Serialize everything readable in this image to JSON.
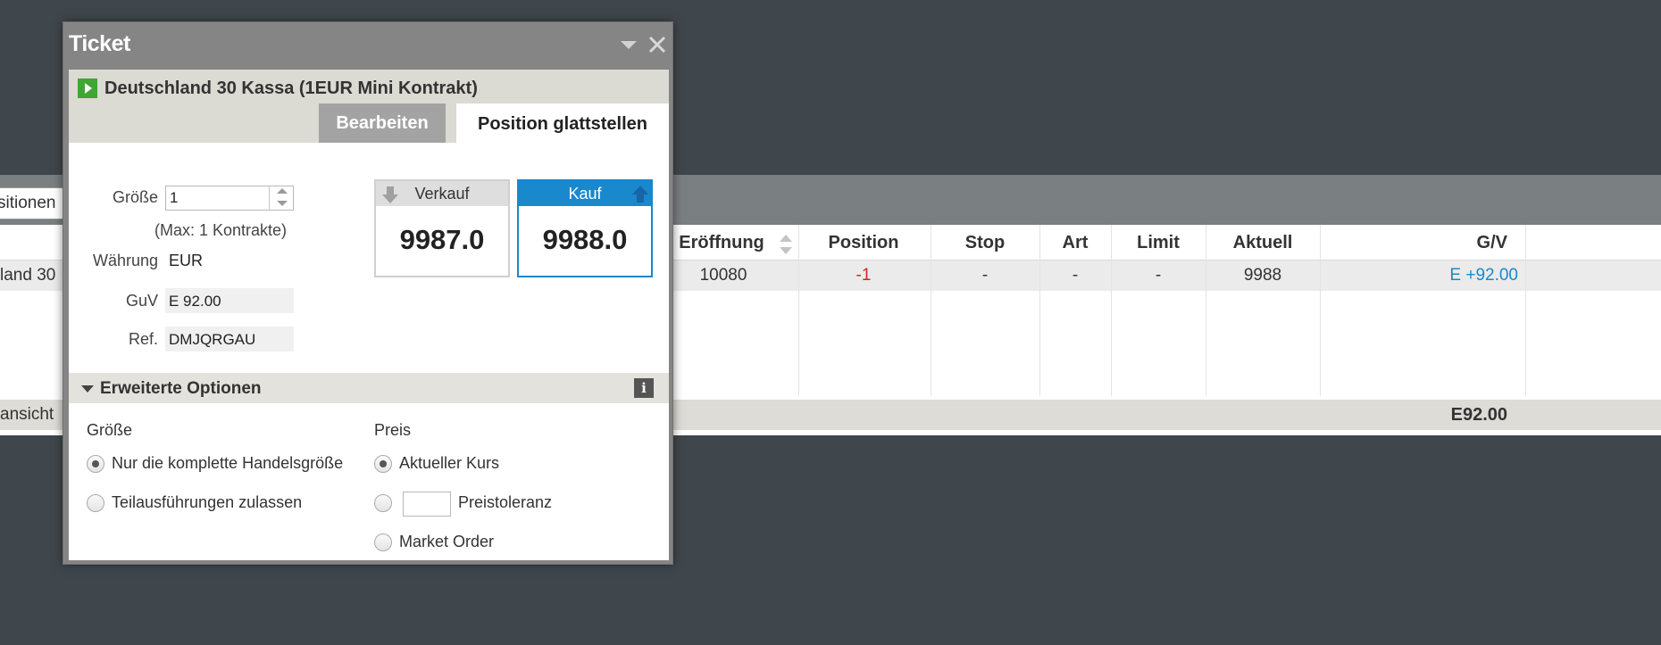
{
  "background": {
    "search_text": "sitionen",
    "columns": [
      "Eröffnung",
      "Position",
      "Stop",
      "Art",
      "Limit",
      "Aktuell",
      "G/V"
    ],
    "row": {
      "instrument": "land 30",
      "eroeffnung": "10080",
      "position": "-1",
      "stop": "-",
      "art": "-",
      "limit": "-",
      "aktuell": "9988",
      "gv": "E +92.00"
    },
    "footer_left": "ansicht",
    "footer_total": "E92.00",
    "colors": {
      "negative": "#cc2a1e",
      "positive": "#1a88cc"
    }
  },
  "ticket": {
    "title": "Ticket",
    "instrument": "Deutschland 30 Kassa (1EUR Mini Kontrakt)",
    "tabs": {
      "edit": "Bearbeiten",
      "close_position": "Position glattstellen"
    },
    "size_label": "Größe",
    "size_value": "1",
    "max_text": "(Max: 1 Kontrakte)",
    "currency_label": "Währung",
    "currency_value": "EUR",
    "pnl_label": "GuV",
    "pnl_value": "E 92.00",
    "ref_label": "Ref.",
    "ref_value": "DMJQRGAU",
    "sell": {
      "label": "Verkauf",
      "price": "9987.0"
    },
    "buy": {
      "label": "Kauf",
      "price": "9988.0"
    },
    "extended": {
      "title": "Erweiterte Optionen",
      "info_icon": "i",
      "size_head": "Größe",
      "price_head": "Preis",
      "size_options": [
        "Nur die komplette Handelsgröße",
        "Teilausführungen zulassen"
      ],
      "price_options": [
        "Aktueller Kurs",
        "Preistoleranz",
        "Market Order"
      ]
    },
    "colors": {
      "accent": "#1a88cc",
      "play": "#3fa535"
    }
  }
}
